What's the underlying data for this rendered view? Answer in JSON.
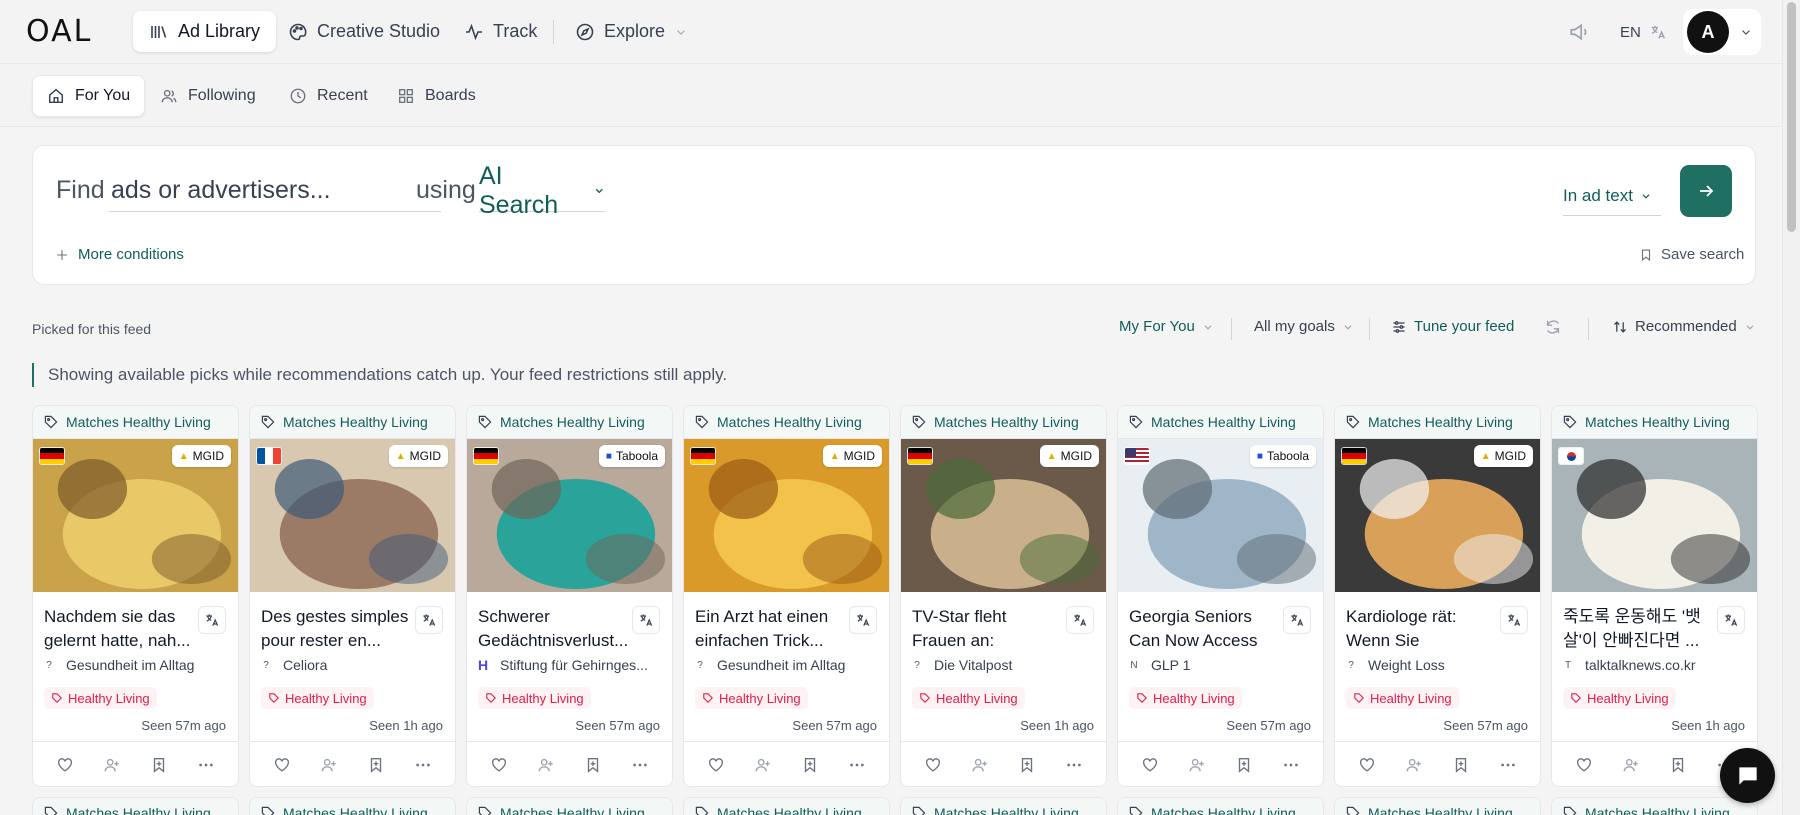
{
  "brand": {
    "logo_text": "OAL"
  },
  "topnav": {
    "items": [
      {
        "label": "Ad Library",
        "icon": "library-icon",
        "active": true
      },
      {
        "label": "Creative Studio",
        "icon": "palette-icon",
        "active": false
      },
      {
        "label": "Track",
        "icon": "activity-icon",
        "active": false
      },
      {
        "label": "Explore",
        "icon": "compass-icon",
        "active": false
      }
    ],
    "language": "EN",
    "avatar_letter": "A"
  },
  "subnav": {
    "items": [
      {
        "label": "For You",
        "icon": "home-icon",
        "active": true
      },
      {
        "label": "Following",
        "icon": "users-icon",
        "active": false
      },
      {
        "label": "Recent",
        "icon": "clock-icon",
        "active": false
      },
      {
        "label": "Boards",
        "icon": "grid-icon",
        "active": false
      }
    ]
  },
  "search": {
    "find_label": "Find",
    "placeholder": "ads or advertisers...",
    "value": "",
    "using_label": "using",
    "mode": "AI Search",
    "scope": "In ad text",
    "more_conditions": "More conditions",
    "save_search": "Save search"
  },
  "feed": {
    "picked_label": "Picked for this feed",
    "feed_select": "My For You",
    "goals_select": "All my goals",
    "tune_label": "Tune your feed",
    "sort_select": "Recommended",
    "notice": "Showing available picks while recommendations catch up. Your feed restrictions still apply."
  },
  "cards": [
    {
      "match": "Matches Healthy Living",
      "country": "DE",
      "network": "MGID",
      "title": "Nachdem sie das gelernt hatte, nah...",
      "advertiser": "Gesundheit im Alltag",
      "advertiser_icon": "?",
      "tag": "Healthy Living",
      "seen": "Seen 57m ago"
    },
    {
      "match": "Matches Healthy Living",
      "country": "FR",
      "network": "MGID",
      "title": "Des gestes simples pour rester en...",
      "advertiser": "Celiora",
      "advertiser_icon": "?",
      "tag": "Healthy Living",
      "seen": "Seen 1h ago"
    },
    {
      "match": "Matches Healthy Living",
      "country": "DE",
      "network": "Taboola",
      "title": "Schwerer Gedächtnisverlust...",
      "advertiser": "Stiftung für Gehirnges...",
      "advertiser_icon": "H",
      "tag": "Healthy Living",
      "seen": "Seen 57m ago"
    },
    {
      "match": "Matches Healthy Living",
      "country": "DE",
      "network": "MGID",
      "title": "Ein Arzt hat einen einfachen Trick...",
      "advertiser": "Gesundheit im Alltag",
      "advertiser_icon": "?",
      "tag": "Healthy Living",
      "seen": "Seen 57m ago"
    },
    {
      "match": "Matches Healthy Living",
      "country": "DE",
      "network": "MGID",
      "title": "TV-Star fleht Frauen an: Stoppt...",
      "advertiser": "Die Vitalpost",
      "advertiser_icon": "?",
      "tag": "Healthy Living",
      "seen": "Seen 1h ago"
    },
    {
      "match": "Matches Healthy Living",
      "country": "US",
      "network": "Taboola",
      "title": "Georgia Seniors Can Now Access Powerful...",
      "advertiser": "GLP 1",
      "advertiser_icon": "N",
      "tag": "Healthy Living",
      "seen": "Seen 57m ago"
    },
    {
      "match": "Matches Healthy Living",
      "country": "DE",
      "network": "MGID",
      "title": "Kardiologe rät: Wenn Sie Bauchfe...",
      "advertiser": "Weight Loss",
      "advertiser_icon": "?",
      "tag": "Healthy Living",
      "seen": "Seen 57m ago"
    },
    {
      "match": "Matches Healthy Living",
      "country": "KR",
      "network": "",
      "title": "죽도록 운동해도 '뱃살'이 안빠진다면 ...",
      "advertiser": "talktalknews.co.kr",
      "advertiser_icon": "T",
      "tag": "Healthy Living",
      "seen": "Seen 1h ago"
    }
  ],
  "next_row_match": "Matches Healthy Living",
  "colors": {
    "accent": "#1f6f62",
    "tag": "#e11d48",
    "bg": "#f4f4f5"
  }
}
